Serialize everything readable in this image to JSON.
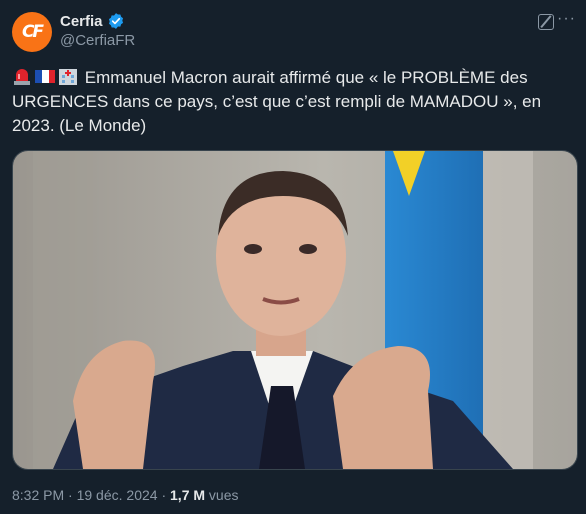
{
  "author": {
    "display_name": "Cerfia",
    "handle": "@CerfiaFR",
    "avatar_initials": "CF",
    "verified": true
  },
  "header_icons": {
    "grok": "grok-icon",
    "more": "more-icon",
    "more_glyph": "···"
  },
  "tweet": {
    "emojis": [
      "rotating-light-emoji",
      "france-flag-emoji",
      "hospital-emoji"
    ],
    "text": "Emmanuel Macron aurait affirmé que « le PROBLÈME des URGENCES dans ce pays, c’est que c’est rempli de MAMADOU », en 2023. (Le Monde)"
  },
  "media": {
    "alt": "Photo d'Emmanuel Macron gesticulant des deux mains, drapeau bleu et jaune à l'arrière-plan"
  },
  "meta": {
    "time": "8:32 PM",
    "sep1": " · ",
    "date": "19 déc. 2024",
    "sep2": " · ",
    "views_count": "1,7 M",
    "views_label": " vues"
  },
  "colors": {
    "background": "#15202b",
    "text": "#e7e9ea",
    "secondary": "#8b98a5",
    "verified": "#1d9bf0",
    "avatar_bg": "#f97316"
  }
}
